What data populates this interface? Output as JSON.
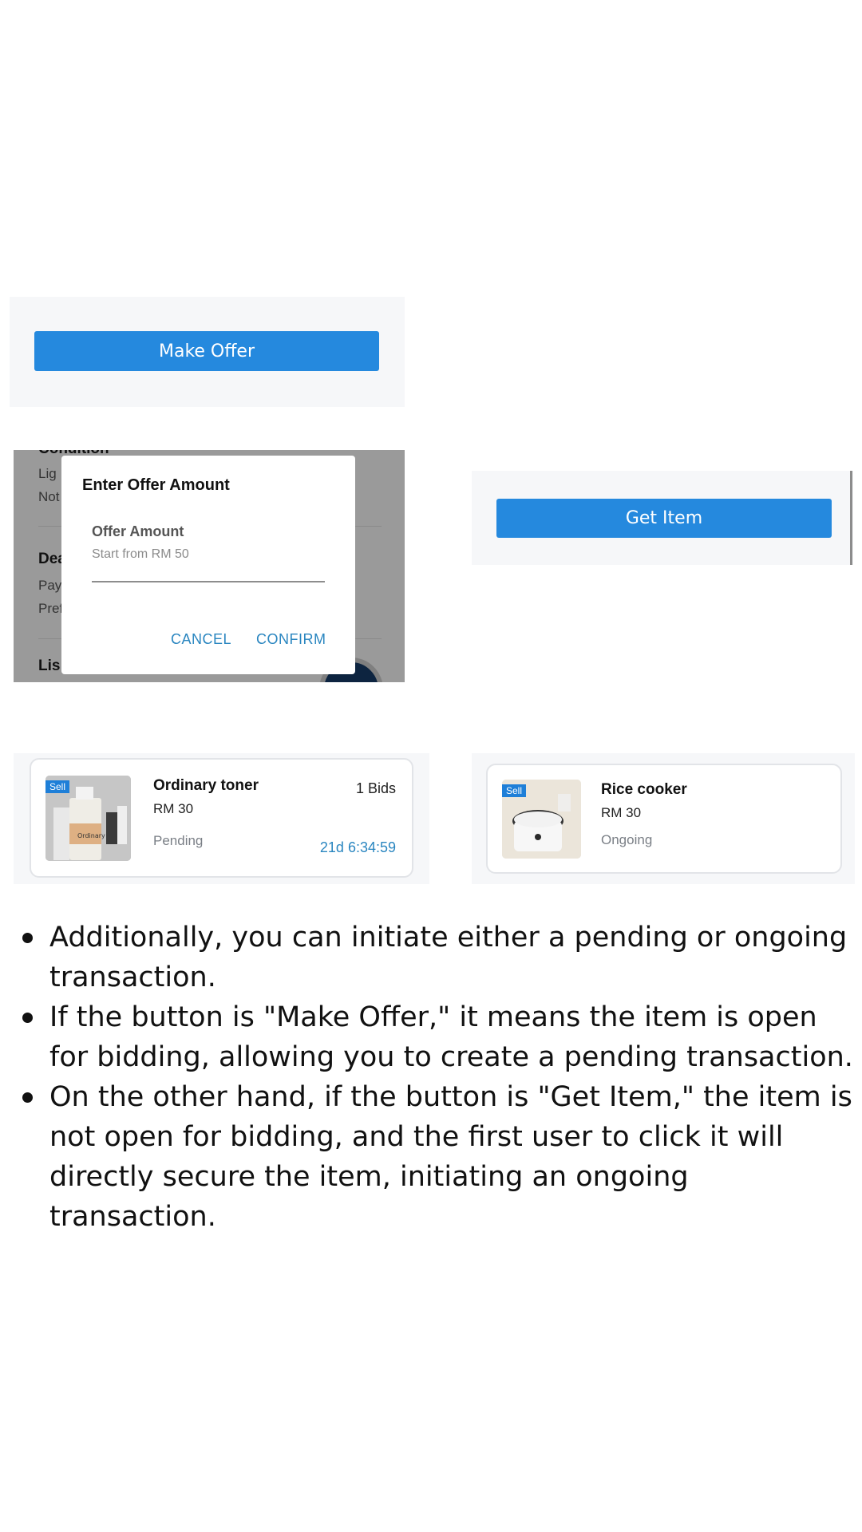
{
  "make_offer_panel": {
    "button_label": "Make Offer"
  },
  "offer_dialog": {
    "background": {
      "condition_heading": "Condition",
      "cond_line1": "Lig",
      "cond_line2": "Not",
      "deal_heading": "Dea",
      "deal_line1": "Pay",
      "deal_line2": "Pref",
      "listing_heading": "Lis"
    },
    "title": "Enter Offer Amount",
    "field_label": "Offer Amount",
    "placeholder": "Start from RM 50",
    "cancel_label": "CANCEL",
    "confirm_label": "CONFIRM"
  },
  "get_item_panel": {
    "button_label": "Get Item"
  },
  "cards": [
    {
      "tag": "Sell",
      "name": "Ordinary toner",
      "price": "RM 30",
      "status": "Pending",
      "bids": "1 Bids",
      "timer": "21d 6:34:59",
      "thumb_label": "Ordinary"
    },
    {
      "tag": "Sell",
      "name": "Rice cooker",
      "price": "RM 30",
      "status": "Ongoing"
    }
  ],
  "bullets": [
    "Additionally, you can initiate either a pending or ongoing transaction.",
    "If the button is \"Make Offer,\" it means the item is open for bidding, allowing you to create a pending transaction.",
    "On the other hand, if the button is \"Get Item,\" the item is not open for bidding, and the first user to click it will directly secure the item, initiating an ongoing transaction."
  ],
  "colors": {
    "primary_button": "#2589de",
    "link_blue": "#2a86c0",
    "sell_tag": "#1e7fd8",
    "panel_bg": "#f6f7f9"
  }
}
